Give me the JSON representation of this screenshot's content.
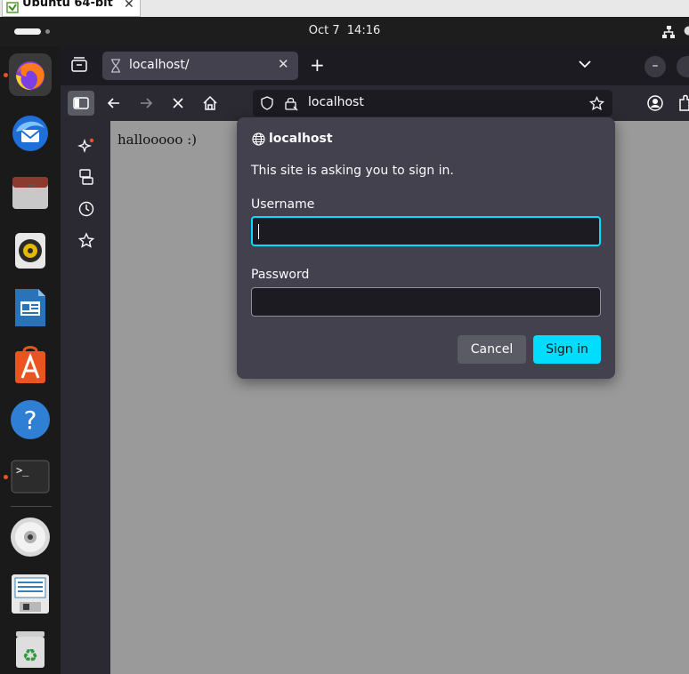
{
  "vm": {
    "tab_title": "Ubuntu 64-bit",
    "tab_close": "✕"
  },
  "topbar": {
    "date": "Oct 7",
    "time": "14:16"
  },
  "dock": {
    "items": [
      "firefox-icon",
      "thunderbird-icon",
      "files-icon",
      "rhythmbox-icon",
      "libreoffice-writer-icon",
      "app-center-icon",
      "help-icon",
      "terminal-icon",
      "dvd-icon",
      "floppy-icon",
      "trash-icon"
    ],
    "help_glyph": "?",
    "terminal_glyph": ">_"
  },
  "browser": {
    "tab_title": "localhost/",
    "tab_close": "✕",
    "new_tab": "+",
    "minimize": "–",
    "url": "localhost",
    "page_text": "hallooooo :)"
  },
  "dialog": {
    "host": "localhost",
    "message": "This site is asking you to sign in.",
    "username_label": "Username",
    "username_value": "",
    "password_label": "Password",
    "password_value": "",
    "cancel_label": "Cancel",
    "signin_label": "Sign in"
  },
  "colors": {
    "accent": "#00ddff",
    "ubuntu_orange": "#e95420",
    "dialog_bg": "#42414d",
    "content_bg": "#9a9a9a"
  }
}
